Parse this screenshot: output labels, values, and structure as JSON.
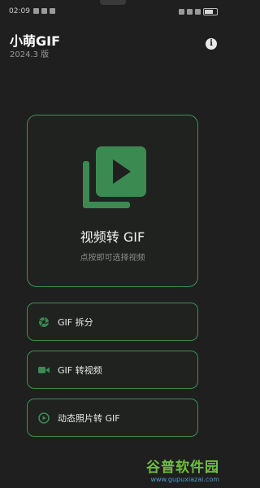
{
  "status_bar": {
    "time": "02:09"
  },
  "header": {
    "title": "小萌GIF",
    "version": "2024.3 版",
    "info_icon": "i"
  },
  "main_card": {
    "title": "视频转 GIF",
    "subtitle": "点按即可选择视频",
    "icon": "video-play-icon"
  },
  "actions": [
    {
      "label": "GIF 拆分",
      "icon": "aperture-icon"
    },
    {
      "label": "GIF 转视频",
      "icon": "video-camera-icon"
    },
    {
      "label": "动态照片转 GIF",
      "icon": "play-circle-icon"
    }
  ],
  "watermark": {
    "text": "谷普软件园",
    "url": "www.gupuxiazai.com"
  },
  "colors": {
    "accent": "#3f8f53",
    "background": "#1f1f1f",
    "icon_green": "#3a8a52"
  }
}
